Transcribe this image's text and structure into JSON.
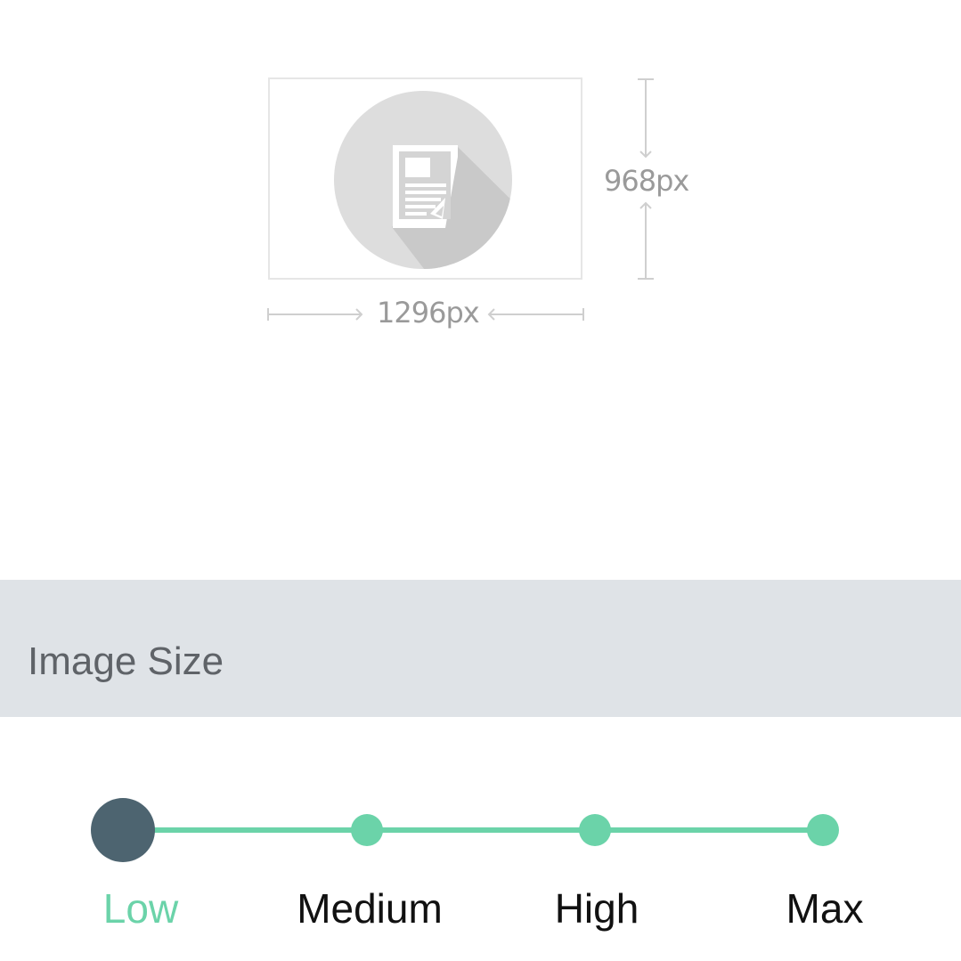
{
  "preview": {
    "height_label": "968px",
    "width_label": "1296px",
    "image_icon": "document-image-icon"
  },
  "section": {
    "title": "Image Size"
  },
  "slider": {
    "selected": "Low",
    "selected_index": 0,
    "accent_color": "#6bd3a9",
    "thumb_color": "#4d6470",
    "options": [
      {
        "label": "Low"
      },
      {
        "label": "Medium"
      },
      {
        "label": "High"
      },
      {
        "label": "Max"
      }
    ]
  }
}
